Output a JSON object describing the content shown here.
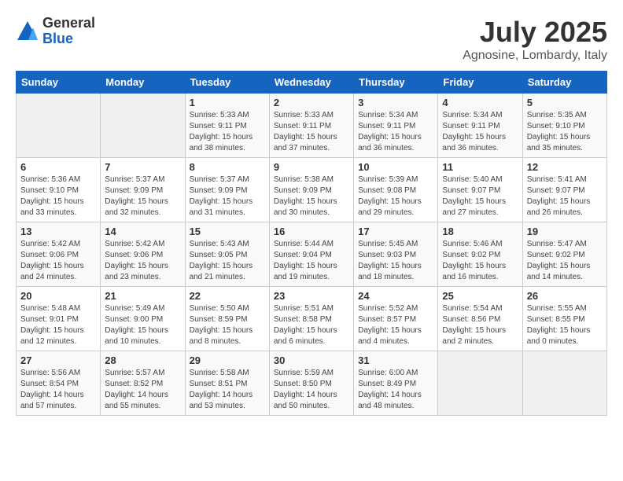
{
  "logo": {
    "general": "General",
    "blue": "Blue"
  },
  "title": "July 2025",
  "location": "Agnosine, Lombardy, Italy",
  "days_of_week": [
    "Sunday",
    "Monday",
    "Tuesday",
    "Wednesday",
    "Thursday",
    "Friday",
    "Saturday"
  ],
  "weeks": [
    [
      {
        "day": "",
        "info": ""
      },
      {
        "day": "",
        "info": ""
      },
      {
        "day": "1",
        "info": "Sunrise: 5:33 AM\nSunset: 9:11 PM\nDaylight: 15 hours and 38 minutes."
      },
      {
        "day": "2",
        "info": "Sunrise: 5:33 AM\nSunset: 9:11 PM\nDaylight: 15 hours and 37 minutes."
      },
      {
        "day": "3",
        "info": "Sunrise: 5:34 AM\nSunset: 9:11 PM\nDaylight: 15 hours and 36 minutes."
      },
      {
        "day": "4",
        "info": "Sunrise: 5:34 AM\nSunset: 9:11 PM\nDaylight: 15 hours and 36 minutes."
      },
      {
        "day": "5",
        "info": "Sunrise: 5:35 AM\nSunset: 9:10 PM\nDaylight: 15 hours and 35 minutes."
      }
    ],
    [
      {
        "day": "6",
        "info": "Sunrise: 5:36 AM\nSunset: 9:10 PM\nDaylight: 15 hours and 33 minutes."
      },
      {
        "day": "7",
        "info": "Sunrise: 5:37 AM\nSunset: 9:09 PM\nDaylight: 15 hours and 32 minutes."
      },
      {
        "day": "8",
        "info": "Sunrise: 5:37 AM\nSunset: 9:09 PM\nDaylight: 15 hours and 31 minutes."
      },
      {
        "day": "9",
        "info": "Sunrise: 5:38 AM\nSunset: 9:09 PM\nDaylight: 15 hours and 30 minutes."
      },
      {
        "day": "10",
        "info": "Sunrise: 5:39 AM\nSunset: 9:08 PM\nDaylight: 15 hours and 29 minutes."
      },
      {
        "day": "11",
        "info": "Sunrise: 5:40 AM\nSunset: 9:07 PM\nDaylight: 15 hours and 27 minutes."
      },
      {
        "day": "12",
        "info": "Sunrise: 5:41 AM\nSunset: 9:07 PM\nDaylight: 15 hours and 26 minutes."
      }
    ],
    [
      {
        "day": "13",
        "info": "Sunrise: 5:42 AM\nSunset: 9:06 PM\nDaylight: 15 hours and 24 minutes."
      },
      {
        "day": "14",
        "info": "Sunrise: 5:42 AM\nSunset: 9:06 PM\nDaylight: 15 hours and 23 minutes."
      },
      {
        "day": "15",
        "info": "Sunrise: 5:43 AM\nSunset: 9:05 PM\nDaylight: 15 hours and 21 minutes."
      },
      {
        "day": "16",
        "info": "Sunrise: 5:44 AM\nSunset: 9:04 PM\nDaylight: 15 hours and 19 minutes."
      },
      {
        "day": "17",
        "info": "Sunrise: 5:45 AM\nSunset: 9:03 PM\nDaylight: 15 hours and 18 minutes."
      },
      {
        "day": "18",
        "info": "Sunrise: 5:46 AM\nSunset: 9:02 PM\nDaylight: 15 hours and 16 minutes."
      },
      {
        "day": "19",
        "info": "Sunrise: 5:47 AM\nSunset: 9:02 PM\nDaylight: 15 hours and 14 minutes."
      }
    ],
    [
      {
        "day": "20",
        "info": "Sunrise: 5:48 AM\nSunset: 9:01 PM\nDaylight: 15 hours and 12 minutes."
      },
      {
        "day": "21",
        "info": "Sunrise: 5:49 AM\nSunset: 9:00 PM\nDaylight: 15 hours and 10 minutes."
      },
      {
        "day": "22",
        "info": "Sunrise: 5:50 AM\nSunset: 8:59 PM\nDaylight: 15 hours and 8 minutes."
      },
      {
        "day": "23",
        "info": "Sunrise: 5:51 AM\nSunset: 8:58 PM\nDaylight: 15 hours and 6 minutes."
      },
      {
        "day": "24",
        "info": "Sunrise: 5:52 AM\nSunset: 8:57 PM\nDaylight: 15 hours and 4 minutes."
      },
      {
        "day": "25",
        "info": "Sunrise: 5:54 AM\nSunset: 8:56 PM\nDaylight: 15 hours and 2 minutes."
      },
      {
        "day": "26",
        "info": "Sunrise: 5:55 AM\nSunset: 8:55 PM\nDaylight: 15 hours and 0 minutes."
      }
    ],
    [
      {
        "day": "27",
        "info": "Sunrise: 5:56 AM\nSunset: 8:54 PM\nDaylight: 14 hours and 57 minutes."
      },
      {
        "day": "28",
        "info": "Sunrise: 5:57 AM\nSunset: 8:52 PM\nDaylight: 14 hours and 55 minutes."
      },
      {
        "day": "29",
        "info": "Sunrise: 5:58 AM\nSunset: 8:51 PM\nDaylight: 14 hours and 53 minutes."
      },
      {
        "day": "30",
        "info": "Sunrise: 5:59 AM\nSunset: 8:50 PM\nDaylight: 14 hours and 50 minutes."
      },
      {
        "day": "31",
        "info": "Sunrise: 6:00 AM\nSunset: 8:49 PM\nDaylight: 14 hours and 48 minutes."
      },
      {
        "day": "",
        "info": ""
      },
      {
        "day": "",
        "info": ""
      }
    ]
  ],
  "empty_weeks": [
    [
      0,
      1
    ],
    [
      5,
      6
    ]
  ]
}
